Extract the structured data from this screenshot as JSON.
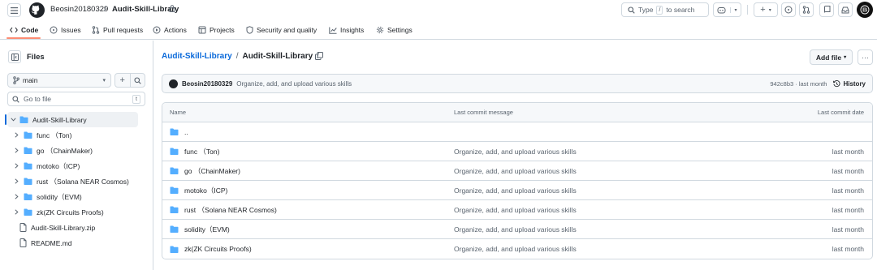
{
  "header": {
    "owner": "Beosin20180329",
    "separator": "/",
    "repo": "Audit-Skill-Library",
    "search_placeholder": "Type",
    "search_key": "/",
    "search_suffix": "to search"
  },
  "nav": {
    "tabs": [
      {
        "label": "Code",
        "icon": "code-icon",
        "active": true
      },
      {
        "label": "Issues",
        "icon": "issue-icon"
      },
      {
        "label": "Pull requests",
        "icon": "pull-request-icon"
      },
      {
        "label": "Actions",
        "icon": "play-icon"
      },
      {
        "label": "Projects",
        "icon": "table-icon"
      },
      {
        "label": "Security and quality",
        "icon": "shield-icon"
      },
      {
        "label": "Insights",
        "icon": "graph-icon"
      },
      {
        "label": "Settings",
        "icon": "gear-icon"
      }
    ]
  },
  "sidebar": {
    "title": "Files",
    "branch": "main",
    "goto_placeholder": "Go to file",
    "goto_key": "t",
    "tree": [
      {
        "label": "Audit-Skill-Library",
        "type": "folder",
        "expanded": true,
        "selected": true
      },
      {
        "label": "func （Ton)",
        "type": "folder"
      },
      {
        "label": "go （ChainMaker)",
        "type": "folder"
      },
      {
        "label": "motoko（ICP)",
        "type": "folder"
      },
      {
        "label": "rust （Solana NEAR Cosmos)",
        "type": "folder"
      },
      {
        "label": "solidity（EVM)",
        "type": "folder"
      },
      {
        "label": "zk(ZK Circuits Proofs)",
        "type": "folder"
      },
      {
        "label": "Audit-Skill-Library.zip",
        "type": "file"
      },
      {
        "label": "README.md",
        "type": "file"
      }
    ]
  },
  "main": {
    "breadcrumb_root": "Audit-Skill-Library",
    "breadcrumb_sep": "/",
    "breadcrumb_current": "Audit-Skill-Library",
    "breadcrumb_trailing": "/",
    "add_file_label": "Add file",
    "more_label": "···",
    "commit": {
      "author": "Beosin20180329",
      "message": "Organize, add, and upload various skills",
      "hash_time": "942c8b3 · last month",
      "history_label": "History"
    },
    "table": {
      "headers": {
        "name": "Name",
        "message": "Last commit message",
        "date": "Last commit date"
      },
      "rows": [
        {
          "name": "..",
          "message": "",
          "date": ""
        },
        {
          "name": "func （Ton)",
          "message": "Organize, add, and upload various skills",
          "date": "last month"
        },
        {
          "name": "go （ChainMaker)",
          "message": "Organize, add, and upload various skills",
          "date": "last month"
        },
        {
          "name": "motoko（ICP)",
          "message": "Organize, add, and upload various skills",
          "date": "last month"
        },
        {
          "name": "rust （Solana NEAR Cosmos)",
          "message": "Organize, add, and upload various skills",
          "date": "last month"
        },
        {
          "name": "solidity（EVM)",
          "message": "Organize, add, and upload various skills",
          "date": "last month"
        },
        {
          "name": "zk(ZK Circuits Proofs)",
          "message": "Organize, add, and upload various skills",
          "date": "last month"
        }
      ]
    }
  },
  "colors": {
    "link": "#0969da",
    "folder": "#54aeff",
    "border": "#d1d9e0",
    "active_tab_underline": "#fd8c73",
    "muted_text": "#59636e"
  }
}
